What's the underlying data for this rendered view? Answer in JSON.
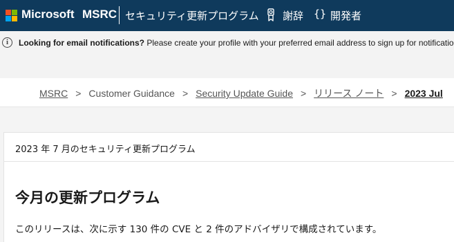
{
  "brand": {
    "logo_colors": [
      "#f25022",
      "#7fba00",
      "#00a4ef",
      "#ffb900"
    ],
    "name": "Microsoft"
  },
  "nav": {
    "msrc": "MSRC",
    "program": "セキュリティ更新プログラム",
    "acknowledgements": "謝辞",
    "developer": "開発者",
    "developer_icon": "{}",
    "background": "#0f3a5c"
  },
  "notice": {
    "icon": "i",
    "bold": "Looking for email notifications?",
    "text": " Please create your profile with your preferred email address to sign up for notifications"
  },
  "breadcrumb": {
    "items": [
      {
        "label": "MSRC"
      },
      {
        "label": "Customer Guidance"
      },
      {
        "label": "Security Update Guide"
      },
      {
        "label": "リリース ノート"
      },
      {
        "label": "2023 Jul"
      }
    ],
    "separator": ">"
  },
  "content": {
    "title": "2023 年 7 月のセキュリティ更新プログラム",
    "heading": "今月の更新プログラム",
    "body": "このリリースは、次に示す 130 件の CVE と 2 件のアドバイザリで構成されています。"
  }
}
